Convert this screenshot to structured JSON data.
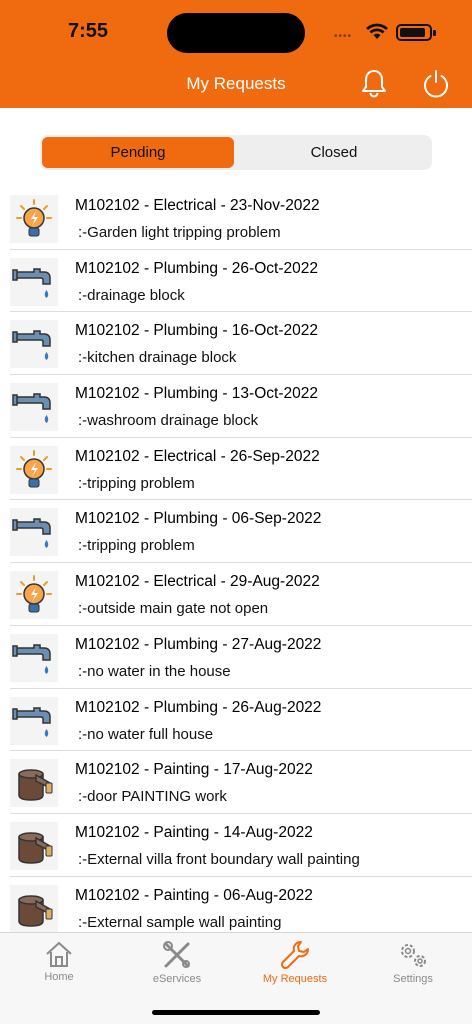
{
  "status_bar": {
    "time": "7:55"
  },
  "header": {
    "title": "My Requests"
  },
  "segments": {
    "pending": "Pending",
    "closed": "Closed",
    "selected": "Pending"
  },
  "requests": [
    {
      "title": "M102102 - Electrical - 23-Nov-2022",
      "desc": ":-Garden light tripping problem",
      "category": "electrical"
    },
    {
      "title": "M102102 - Plumbing - 26-Oct-2022",
      "desc": ":-drainage block",
      "category": "plumbing"
    },
    {
      "title": "M102102 - Plumbing - 16-Oct-2022",
      "desc": ":-kitchen drainage block",
      "category": "plumbing"
    },
    {
      "title": "M102102 - Plumbing - 13-Oct-2022",
      "desc": ":-washroom drainage block",
      "category": "plumbing"
    },
    {
      "title": "M102102 - Electrical - 26-Sep-2022",
      "desc": ":-tripping problem",
      "category": "electrical"
    },
    {
      "title": "M102102 - Plumbing - 06-Sep-2022",
      "desc": ":-tripping problem",
      "category": "plumbing"
    },
    {
      "title": "M102102 - Electrical - 29-Aug-2022",
      "desc": ":-outside main gate not open",
      "category": "electrical"
    },
    {
      "title": "M102102 - Plumbing - 27-Aug-2022",
      "desc": ":-no water in the house",
      "category": "plumbing"
    },
    {
      "title": "M102102 - Plumbing - 26-Aug-2022",
      "desc": ":-no water full house",
      "category": "plumbing"
    },
    {
      "title": "M102102 - Painting - 17-Aug-2022",
      "desc": ":-door PAINTING work",
      "category": "painting"
    },
    {
      "title": "M102102 - Painting - 14-Aug-2022",
      "desc": ":-External villa front boundary wall painting",
      "category": "painting"
    },
    {
      "title": "M102102 - Painting - 06-Aug-2022",
      "desc": ":-External sample  wall painting",
      "category": "painting"
    }
  ],
  "tabbar": {
    "home": "Home",
    "eservices": "eServices",
    "my_requests": "My Requests",
    "settings": "Settings",
    "active": "My Requests"
  },
  "colors": {
    "accent": "#f06a0f",
    "inactive": "#8a8a8a"
  }
}
